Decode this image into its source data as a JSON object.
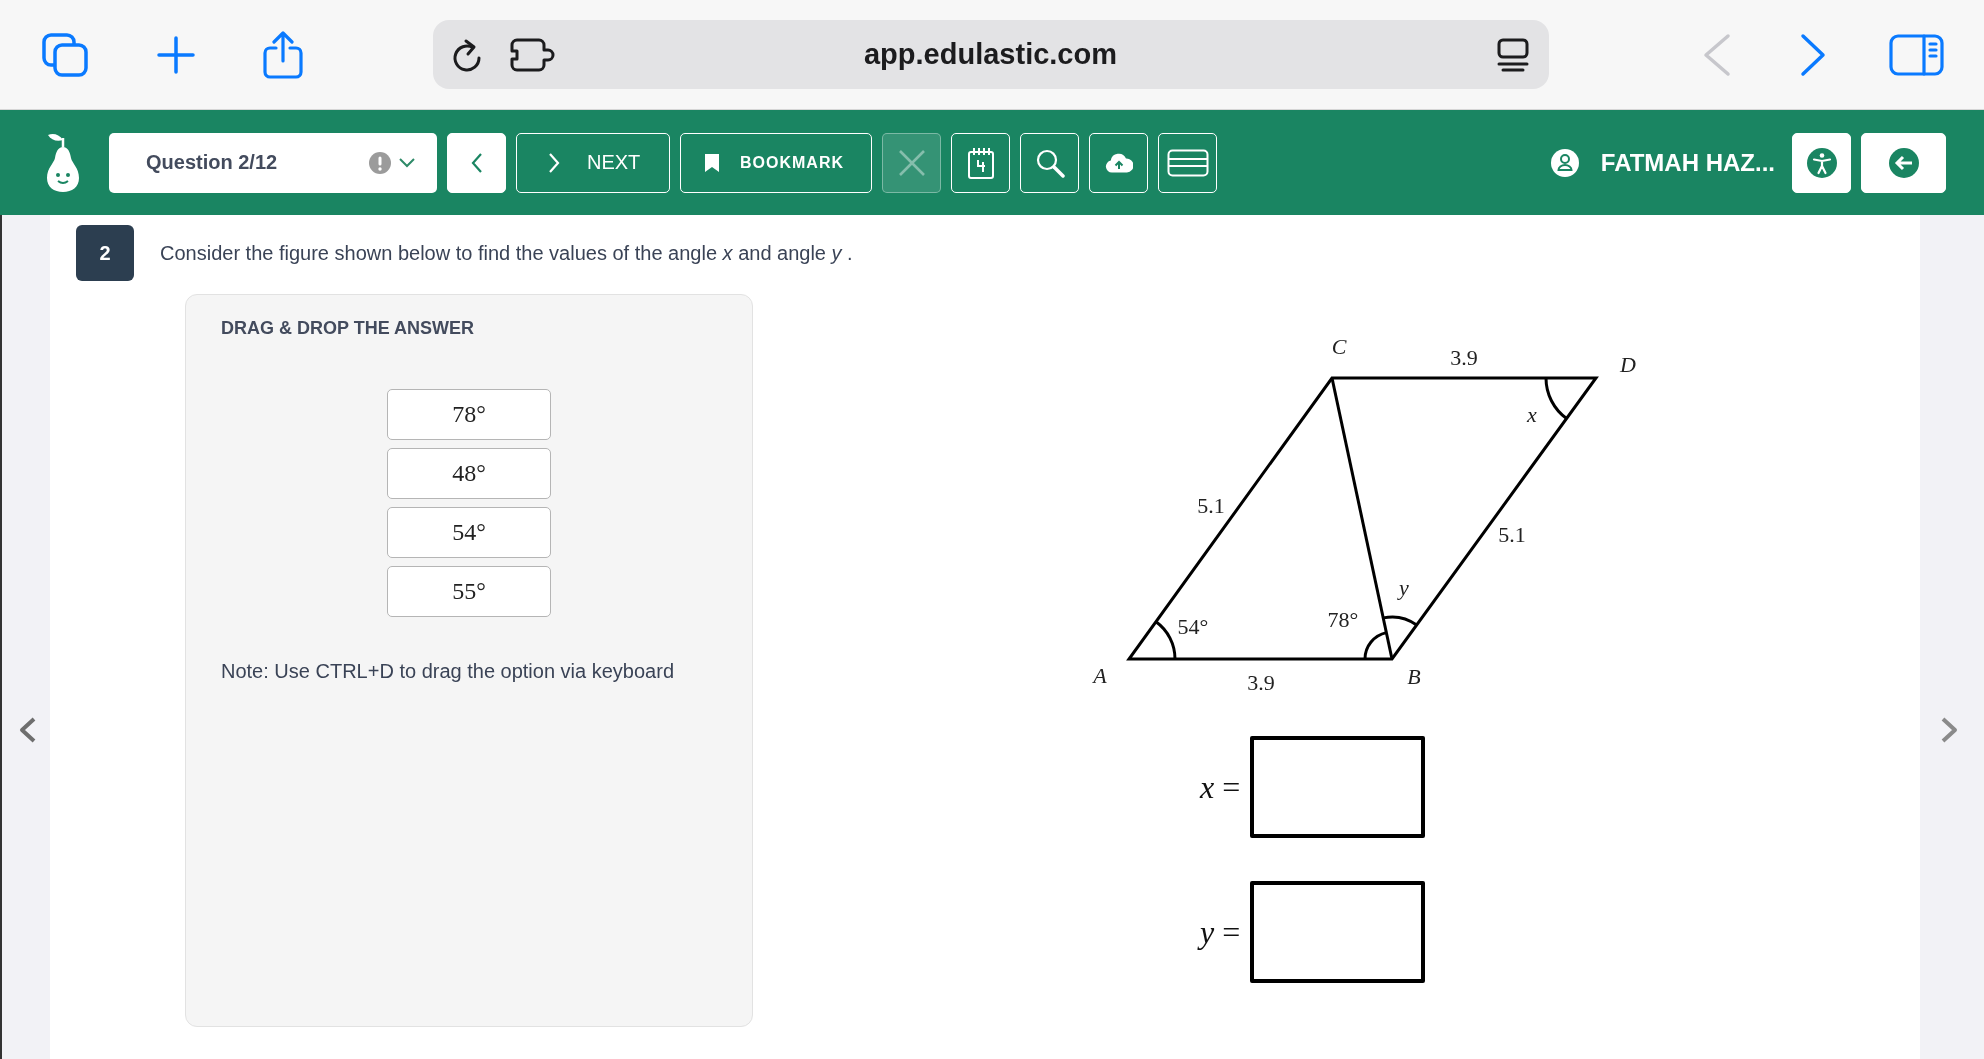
{
  "browser": {
    "url": "app.edulastic.com",
    "nav": [
      {
        "kind": "back",
        "disabled": true
      },
      {
        "kind": "forward",
        "disabled": false
      }
    ]
  },
  "toolbar": {
    "question_selector": {
      "label": "Question 2/12"
    },
    "nav_buttons": [
      {
        "kind": "prev"
      },
      {
        "kind": "next",
        "label": "NEXT"
      },
      {
        "kind": "bookmark",
        "label": "BOOKMARK"
      }
    ],
    "tools": [
      {
        "kind": "clear",
        "disabled": true
      },
      {
        "kind": "scratchpad",
        "disabled": false
      },
      {
        "kind": "zoom",
        "disabled": false
      },
      {
        "kind": "upload",
        "disabled": false
      },
      {
        "kind": "menu",
        "disabled": false
      }
    ],
    "user_name": "FATMAH HAZ..."
  },
  "question": {
    "number": "2",
    "text": "Consider the figure shown below to find the values of the angle *x* and angle *y* ."
  },
  "drag_drop": {
    "title": "DRAG & DROP THE ANSWER",
    "options": [
      "78°",
      "48°",
      "54°",
      "55°"
    ],
    "note": "Note: Use CTRL+D to drag the option via keyboard"
  },
  "figure": {
    "vertex_labels": [
      "C",
      "D",
      "A",
      "B"
    ],
    "side_labels": [
      "3.9",
      "5.1",
      "5.1",
      "3.9"
    ],
    "angle_labels": [
      {
        "text": "x",
        "kind": "variable"
      },
      {
        "text": "y",
        "kind": "variable"
      },
      {
        "text": "54°",
        "kind": "measure"
      },
      {
        "text": "78°",
        "kind": "measure"
      }
    ]
  },
  "answers": [
    {
      "label": "*x* ="
    },
    {
      "label": "*y* ="
    }
  ]
}
